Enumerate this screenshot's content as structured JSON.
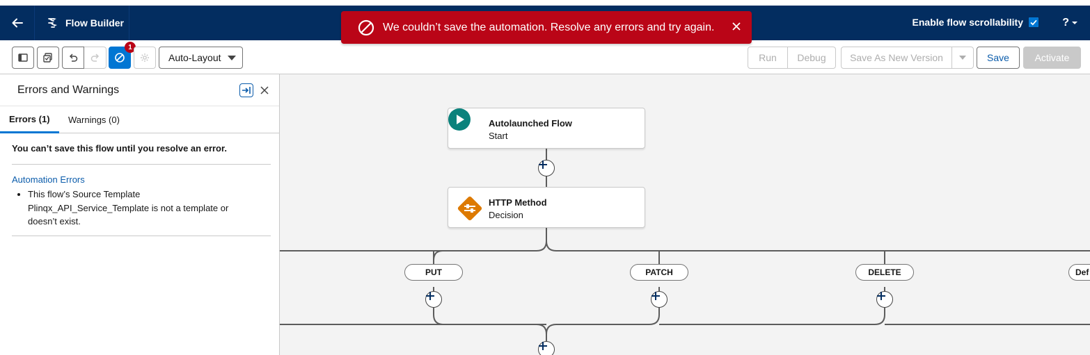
{
  "header": {
    "app_title": "Flow Builder",
    "scrollability_label": "Enable flow scrollability",
    "scrollability_checked": true,
    "help_label": "?"
  },
  "toast": {
    "message": "We couldn’t save the automation. Resolve any errors and try again.",
    "color": "#ba0517"
  },
  "toolbar": {
    "error_badge_count": "1",
    "layout_select": "Auto-Layout",
    "run_label": "Run",
    "debug_label": "Debug",
    "save_as_new_label": "Save As New Version",
    "save_label": "Save",
    "activate_label": "Activate"
  },
  "panel": {
    "title": "Errors and Warnings",
    "tabs": [
      {
        "label": "Errors (1)",
        "selected": true
      },
      {
        "label": "Warnings (0)",
        "selected": false
      }
    ],
    "summary": "You can’t save this flow until you resolve an error.",
    "errors_heading": "Automation Errors",
    "errors": [
      "This flow’s Source Template Plinqx_API_Service_Template is not a template or doesn’t exist."
    ]
  },
  "canvas": {
    "start_node": {
      "title": "Autolaunched Flow",
      "subtitle": "Start",
      "icon": "play-icon",
      "color": "#0b827c"
    },
    "decision_node": {
      "title": "HTTP Method",
      "subtitle": "Decision",
      "icon": "decision-icon",
      "color": "#dd7a01"
    },
    "branches": [
      "PUT",
      "PATCH",
      "DELETE",
      "Def"
    ]
  },
  "colors": {
    "header": "#032d60",
    "brand": "#0176d3",
    "link": "#0b5cab"
  }
}
